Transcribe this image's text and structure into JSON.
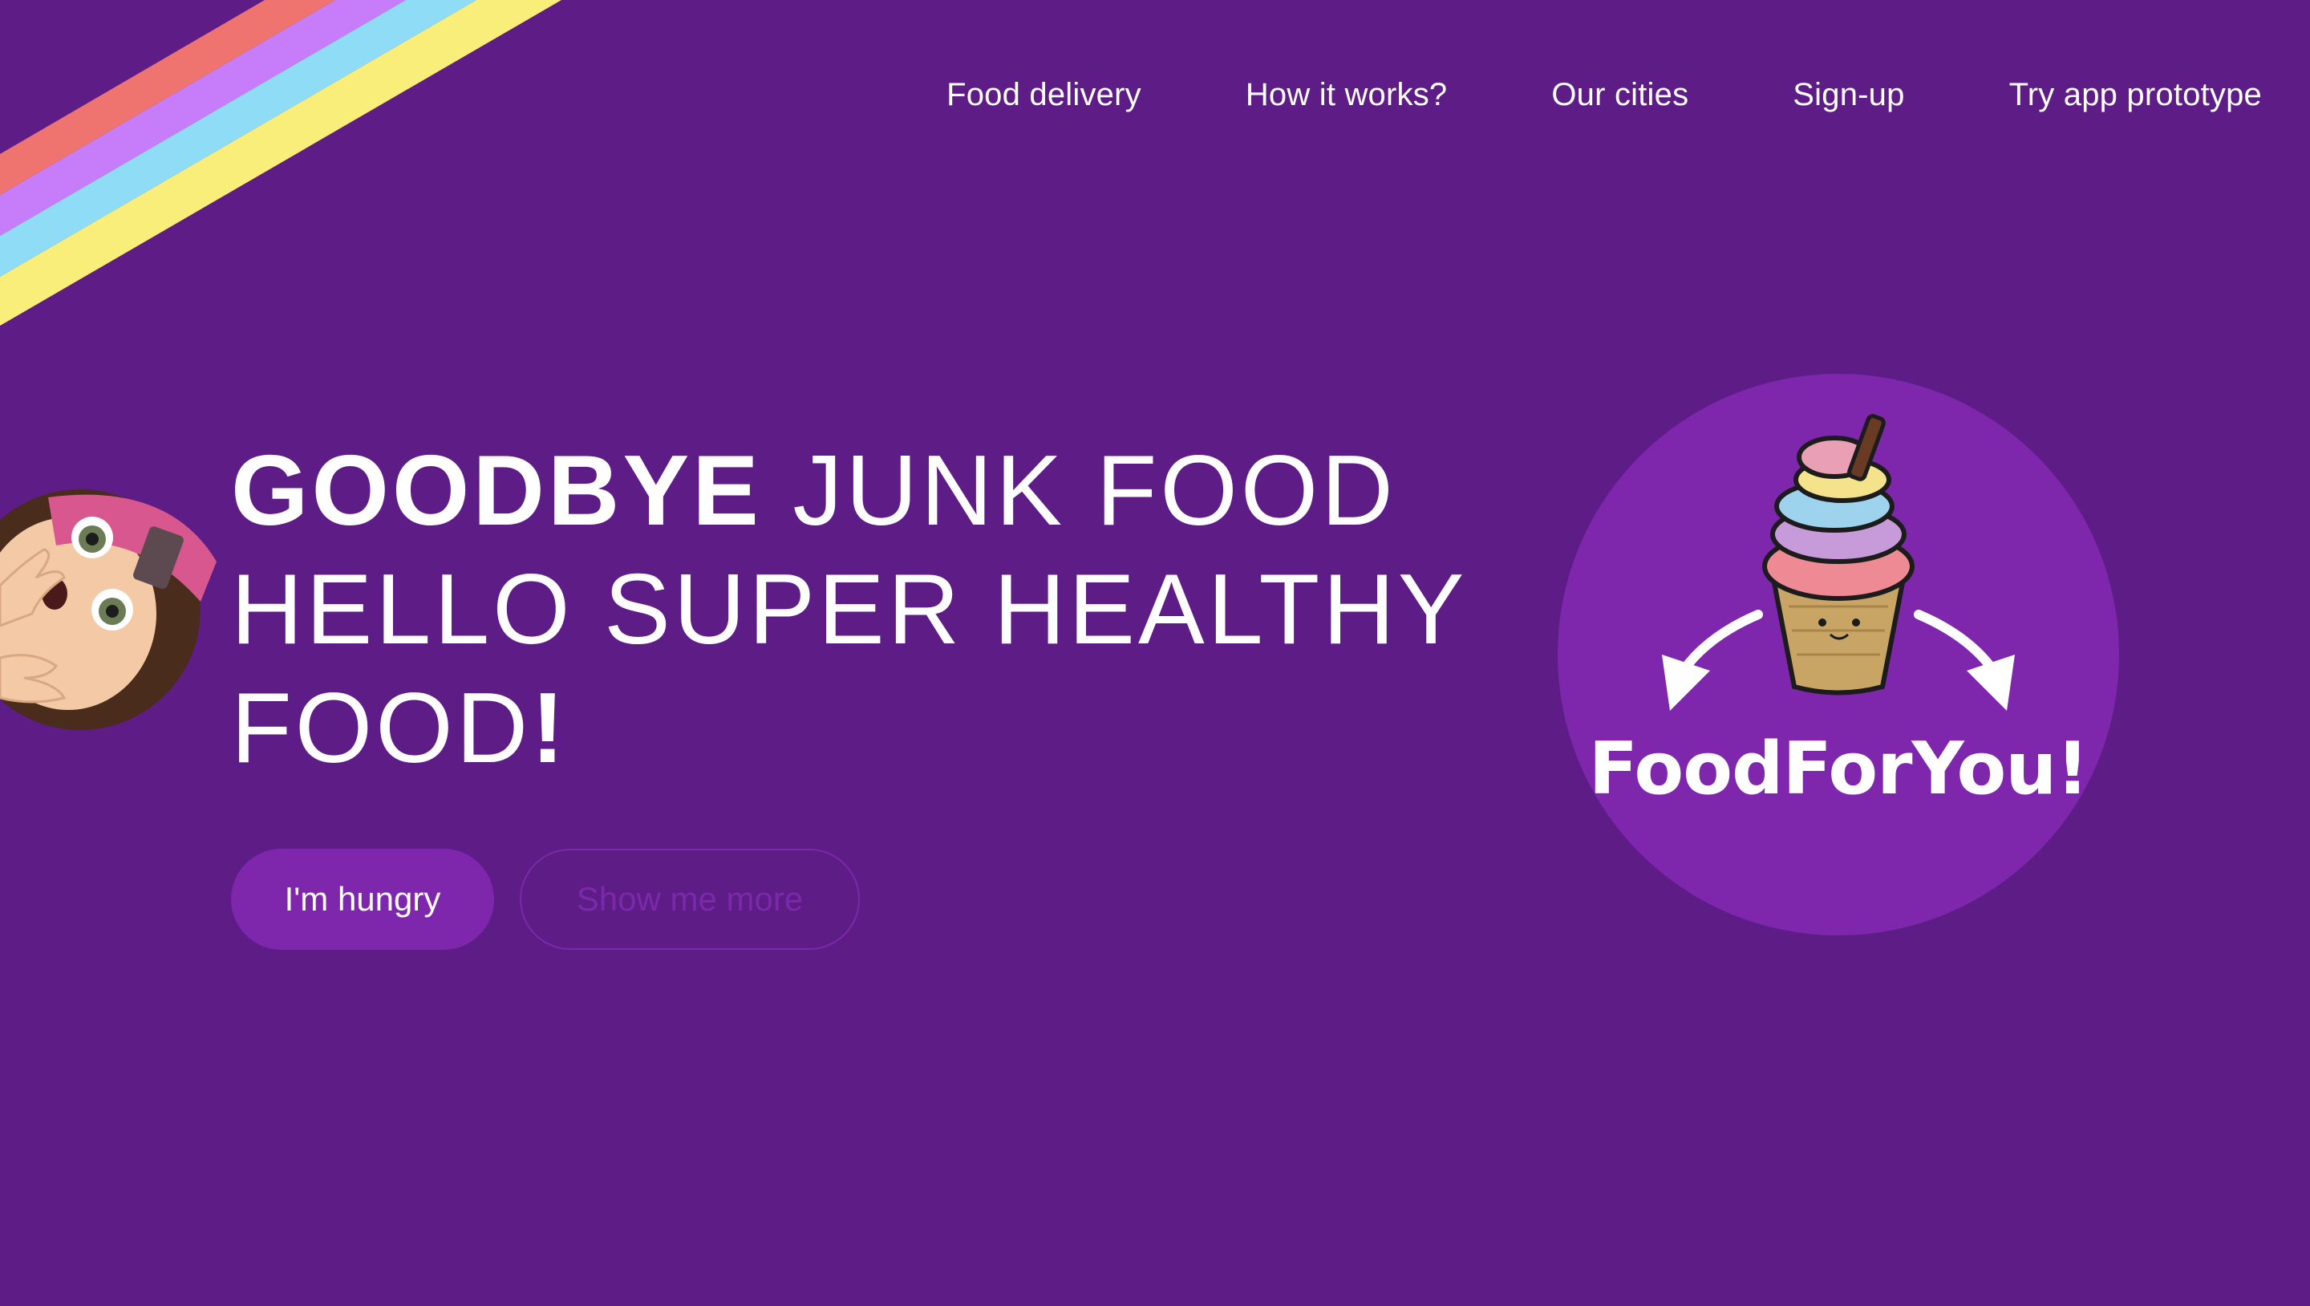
{
  "nav": {
    "items": [
      {
        "label": "Food delivery"
      },
      {
        "label": "How it works?"
      },
      {
        "label": "Our cities"
      },
      {
        "label": "Sign-up"
      },
      {
        "label": "Try app prototype"
      }
    ]
  },
  "hero": {
    "headline_strong": "GOODBYE",
    "headline_rest_1": " JUNK FOOD",
    "headline_line_2": "HELLO SUPER HEALTHY",
    "headline_line_3": "FOOD",
    "headline_exclaim": "!"
  },
  "buttons": {
    "primary_label": "I'm hungry",
    "secondary_label": "Show me more"
  },
  "logo": {
    "text": "FoodForYou!"
  },
  "colors": {
    "background": "#5e1c87",
    "accent": "#7e27ad",
    "stripe_red": "#ef7470",
    "stripe_purple": "#c77dfa",
    "stripe_blue": "#8fdcf7",
    "stripe_yellow": "#f9ee7a"
  },
  "icons": {
    "logo_illustration": "ice-cream-icon",
    "avatar": "girl-avatar-icon"
  }
}
